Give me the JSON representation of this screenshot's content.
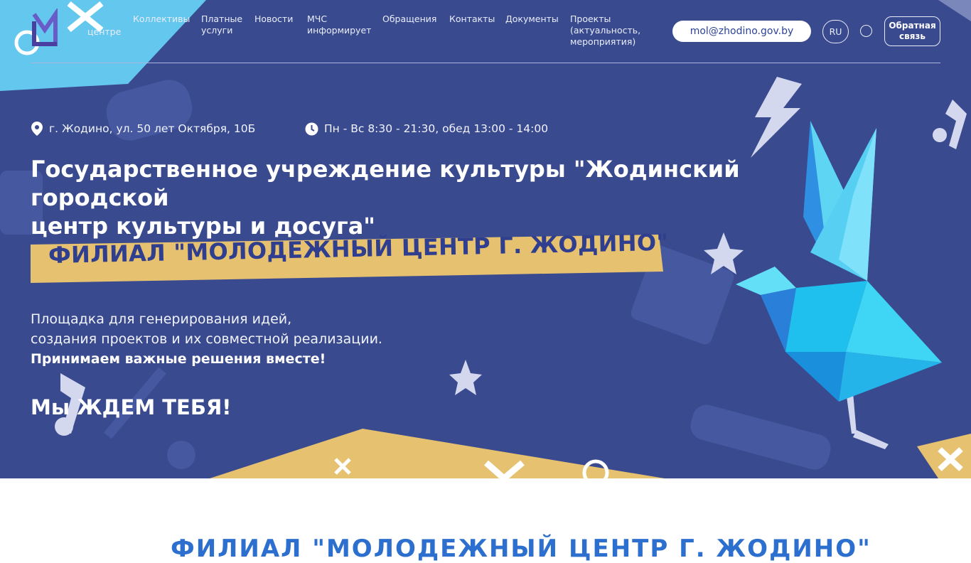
{
  "nav": {
    "items": [
      {
        "label": "центре"
      },
      {
        "label": "Коллективы"
      },
      {
        "label": "Платные\nуслуги"
      },
      {
        "label": "Новости"
      },
      {
        "label": "МЧС\nинформирует"
      },
      {
        "label": "Обращения"
      },
      {
        "label": "Контакты"
      },
      {
        "label": "Документы"
      },
      {
        "label": "Проекты\n(актуальность,\nмероприятия)"
      }
    ],
    "email": "mol@zhodino.gov.by",
    "language": "RU",
    "feedback": "Обратная\nсвязь"
  },
  "hero": {
    "address": "г. Жодино, ул. 50 лет Октября, 10Б",
    "hours": "Пн - Вс 8:30 - 21:30, обед 13:00 - 14:00",
    "title": "Государственное учреждение культуры \"Жодинский городской\nцентр культуры и досуга\"",
    "banner": "ФИЛИАЛ \"МОЛОДЕЖНЫЙ ЦЕНТР Г. ЖОДИНО\"",
    "description_line1": "Площадка для генерирования идей,",
    "description_line2": "создания проектов и их совместной реализации.",
    "description_bold": "Принимаем важные решения вместе!",
    "cta": "Мы ЖДЕМ ТЕБЯ!"
  },
  "next_section": {
    "title": "ФИЛИАЛ \"МОЛОДЕЖНЫЙ ЦЕНТР Г. ЖОДИНО\""
  },
  "colors": {
    "hero_bg": "#3a4a8f",
    "accent_yellow": "#e6c170",
    "accent_cyan": "#63d0f0",
    "link_blue": "#2c4396"
  },
  "icons": [
    "logo-icon",
    "location-pin-icon",
    "clock-icon",
    "ring-icon",
    "origami-bird-icon"
  ]
}
